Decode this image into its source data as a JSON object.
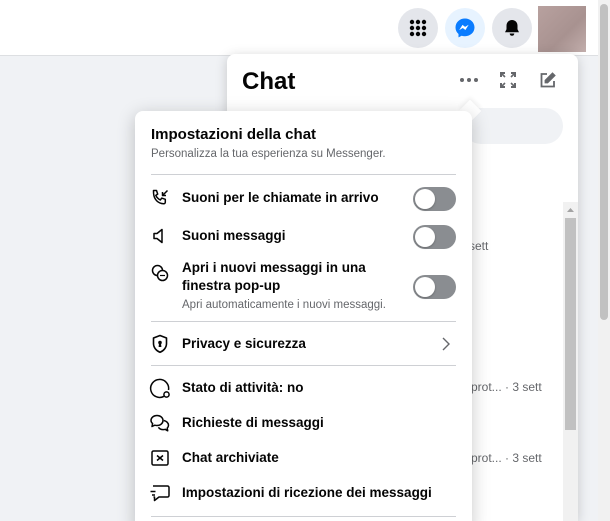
{
  "topbar": {
    "icons": [
      "apps-grid-icon",
      "messenger-icon",
      "bell-icon"
    ],
    "colors": {
      "messenger_accent": "#0a7cff",
      "toggle_off": "#8a8d91"
    }
  },
  "chat_panel": {
    "title": "Chat",
    "header_icons": [
      "more-options-icon",
      "expand-icon",
      "new-message-icon"
    ],
    "background_snippets": {
      "first": "sett",
      "second": "prot... · 3 sett",
      "third": "prot... · 3 sett"
    }
  },
  "settings": {
    "title": "Impostazioni della chat",
    "subtitle": "Personalizza la tua esperienza su Messenger.",
    "toggles": [
      {
        "label": "Suoni per le chiamate in arrivo",
        "icon": "incoming-call-icon",
        "on": false
      },
      {
        "label": "Suoni messaggi",
        "icon": "speaker-icon",
        "on": false
      },
      {
        "label_line1": "Apri i nuovi messaggi in una",
        "label_line2": "finestra pop-up",
        "description": "Apri automaticamente i nuovi messaggi.",
        "icon": "popup-chat-icon",
        "on": false
      }
    ],
    "privacy": {
      "label": "Privacy e sicurezza",
      "icon": "shield-icon"
    },
    "items": [
      {
        "label": "Stato di attività: no",
        "icon": "active-status-icon"
      },
      {
        "label": "Richieste di messaggi",
        "icon": "message-requests-icon"
      },
      {
        "label": "Chat archiviate",
        "icon": "archive-icon"
      },
      {
        "label": "Impostazioni di ricezione dei messaggi",
        "icon": "delivery-settings-icon"
      }
    ]
  }
}
